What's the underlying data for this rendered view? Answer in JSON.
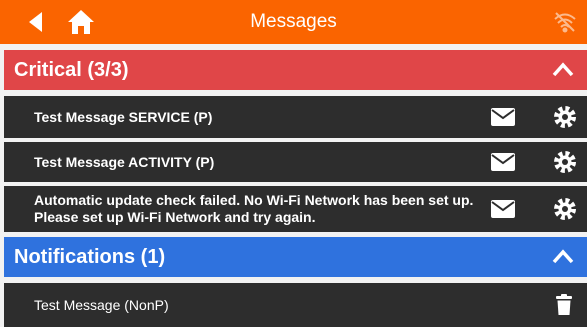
{
  "header": {
    "title": "Messages",
    "icons": {
      "back": "back-arrow-icon",
      "home": "home-icon",
      "status": "wifi-off-icon"
    }
  },
  "sections": {
    "critical": {
      "label": "Critical  (3/3)",
      "color": "#e04648",
      "messages": [
        {
          "text": "Test Message SERVICE (P)",
          "icons": [
            "envelope-icon",
            "gear-icon"
          ]
        },
        {
          "text": "Test Message ACTIVITY (P)",
          "icons": [
            "envelope-icon",
            "gear-icon"
          ]
        },
        {
          "text": "Automatic update check failed. No Wi-Fi Network has been set up. Please set up Wi-Fi Network and try again.",
          "icons": [
            "envelope-icon",
            "gear-icon"
          ]
        }
      ]
    },
    "notifications": {
      "label": "Notifications  (1)",
      "color": "#2f72de",
      "messages": [
        {
          "text": "Test Message (NonP)",
          "icons": [
            "trash-icon"
          ]
        }
      ]
    }
  },
  "colors": {
    "header": "#fa6400",
    "row_bg": "#2d2d2d",
    "page_bg": "#f2f2f2"
  }
}
